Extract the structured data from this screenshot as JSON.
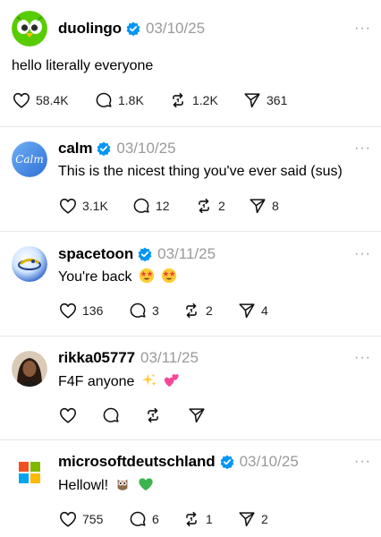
{
  "posts": [
    {
      "username": "duolingo",
      "verified": true,
      "date": "03/10/25",
      "text": "hello literally everyone",
      "likes": "58.4K",
      "replies": "1.8K",
      "reposts": "1.2K",
      "shares": "361",
      "avatar": "duolingo-owl-logo"
    },
    {
      "username": "calm",
      "verified": true,
      "date": "03/10/25",
      "text": "This is the nicest thing you've ever said (sus)",
      "likes": "3.1K",
      "replies": "12",
      "reposts": "2",
      "shares": "8",
      "avatar": "calm-logo",
      "avatar_text": "Calm"
    },
    {
      "username": "spacetoon",
      "verified": true,
      "date": "03/11/25",
      "text": "You're back",
      "emojis": [
        "star-struck-emoji",
        "star-struck-emoji"
      ],
      "likes": "136",
      "replies": "3",
      "reposts": "2",
      "shares": "4",
      "avatar": "spacetoon-logo"
    },
    {
      "username": "rikka05777",
      "verified": false,
      "date": "03/11/25",
      "text": "F4F anyone",
      "emojis": [
        "sparkles-emoji",
        "two-hearts-emoji"
      ],
      "likes": "",
      "replies": "",
      "reposts": "",
      "shares": "",
      "avatar": "user-photo"
    },
    {
      "username": "microsoftdeutschland",
      "verified": true,
      "date": "03/10/25",
      "text": "Hellowl!",
      "emojis": [
        "owl-emoji",
        "green-heart-emoji"
      ],
      "likes": "755",
      "replies": "6",
      "reposts": "1",
      "shares": "2",
      "avatar": "microsoft-logo"
    }
  ],
  "more_label": "···",
  "colors": {
    "verified": "#0095f6",
    "date": "#9a9a9a",
    "separator": "#e6e6e6",
    "duolingo_green": "#58cc02",
    "calm_blue": "#3f8ee8"
  }
}
